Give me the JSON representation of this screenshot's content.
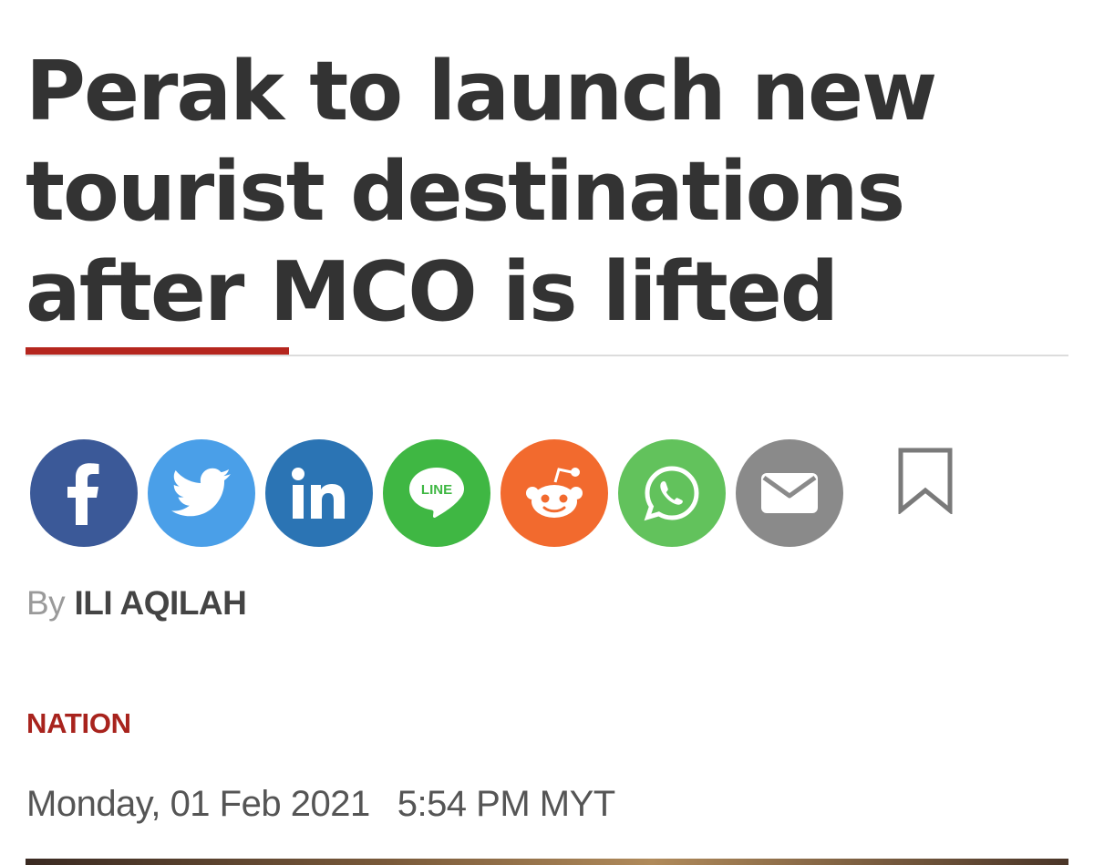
{
  "article": {
    "headline": "Perak to launch new tourist destinations after MCO is lifted",
    "byline_prefix": "By",
    "author": "ILI AQILAH",
    "category": "NATION",
    "date": "Monday, 01 Feb 2021",
    "time": "5:54 PM MYT"
  },
  "share": {
    "buttons": [
      {
        "name": "facebook",
        "icon": "facebook-icon",
        "color": "#3b5998"
      },
      {
        "name": "twitter",
        "icon": "twitter-icon",
        "color": "#4a9fe8"
      },
      {
        "name": "linkedin",
        "icon": "linkedin-icon",
        "color": "#2b74b4"
      },
      {
        "name": "line",
        "icon": "line-icon",
        "label": "LINE",
        "color": "#3fb743"
      },
      {
        "name": "reddit",
        "icon": "reddit-icon",
        "color": "#f26a2e"
      },
      {
        "name": "whatsapp",
        "icon": "whatsapp-icon",
        "color": "#62c25c"
      },
      {
        "name": "email",
        "icon": "envelope-icon",
        "color": "#8a8a8a"
      }
    ],
    "bookmark_icon": "bookmark-icon"
  },
  "colors": {
    "accent": "#b5261e",
    "category": "#a8231d",
    "headline": "#333333"
  }
}
